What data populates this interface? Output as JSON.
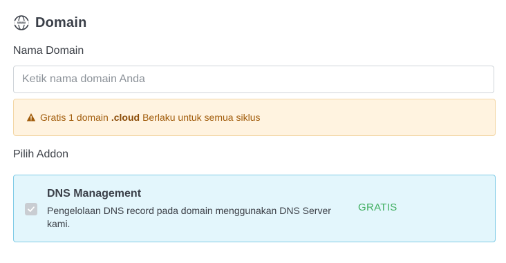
{
  "section": {
    "title": "Domain",
    "icon": "www-globe-icon"
  },
  "domain_field": {
    "label": "Nama Domain",
    "value": "",
    "placeholder": "Ketik nama domain Anda"
  },
  "notice": {
    "icon": "warning-icon",
    "prefix": "Gratis 1 domain",
    "highlight": ".cloud",
    "suffix": "Berlaku untuk semua siklus",
    "color": "#a15c0b",
    "background": "#fff3e0"
  },
  "addons": {
    "label": "Pilih Addon",
    "items": [
      {
        "name": "DNS Management",
        "description": "Pengelolaan DNS record pada domain menggunakan DNS Server kami.",
        "price": "GRATIS",
        "checked": true,
        "price_color": "#3fae5f"
      }
    ]
  }
}
